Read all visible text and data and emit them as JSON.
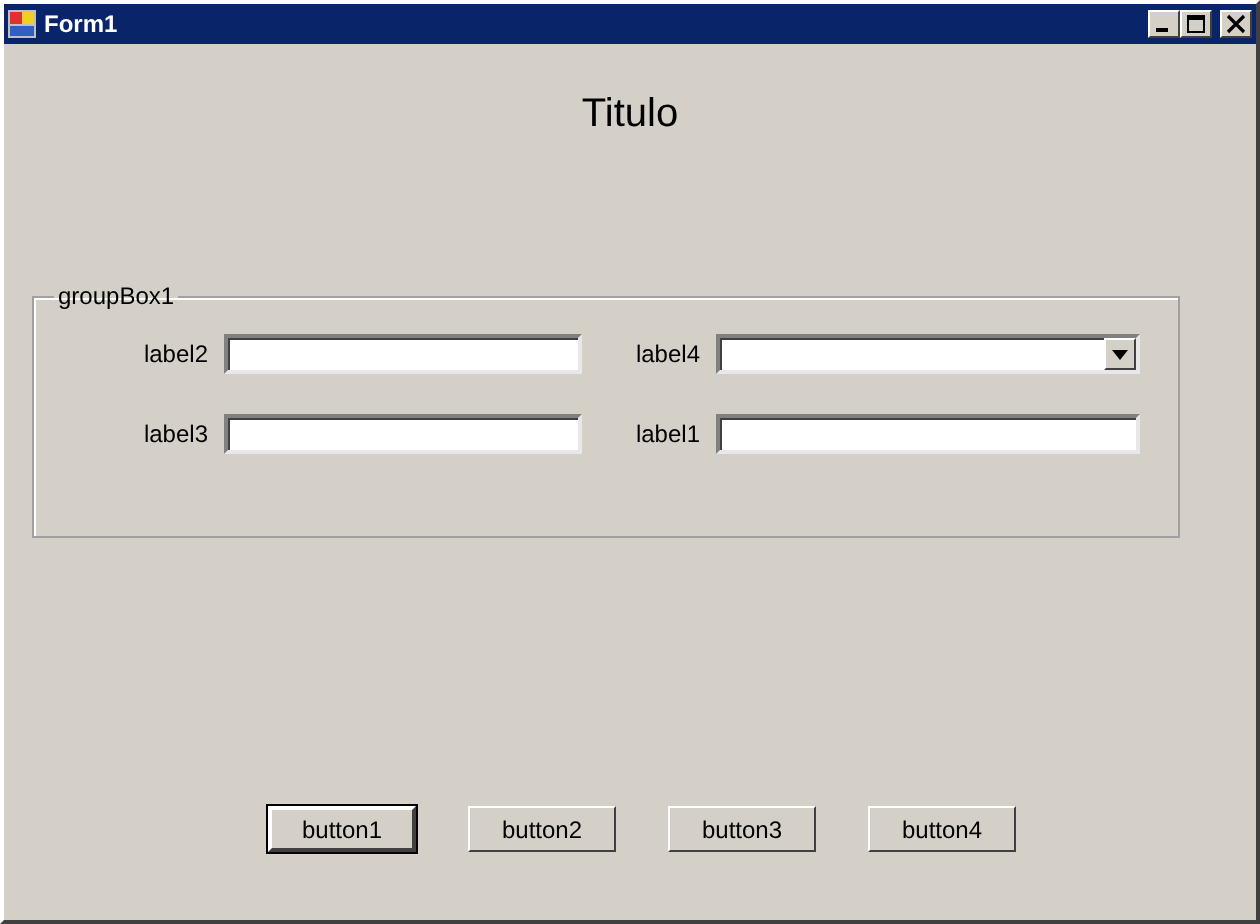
{
  "window": {
    "title": "Form1"
  },
  "heading": "Titulo",
  "group": {
    "label": "groupBox1",
    "fields": [
      {
        "label": "label2",
        "kind": "text"
      },
      {
        "label": "label4",
        "kind": "combo"
      },
      {
        "label": "label3",
        "kind": "text"
      },
      {
        "label": "label1",
        "kind": "text"
      }
    ]
  },
  "buttons": [
    {
      "label": "button1",
      "default": true
    },
    {
      "label": "button2",
      "default": false
    },
    {
      "label": "button3",
      "default": false
    },
    {
      "label": "button4",
      "default": false
    }
  ]
}
